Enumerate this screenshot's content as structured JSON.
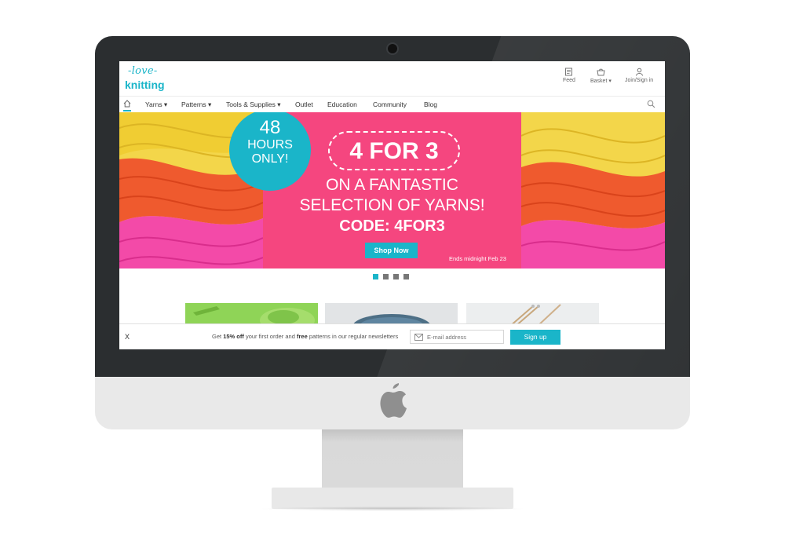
{
  "site": {
    "logo_top": "-love-",
    "logo_bottom": "knitting"
  },
  "header_tools": [
    {
      "label": "Feed",
      "icon": "feed-icon"
    },
    {
      "label": "Basket ▾",
      "icon": "basket-icon"
    },
    {
      "label": "Join/Sign in",
      "icon": "user-icon"
    }
  ],
  "nav": {
    "items": [
      {
        "label": "Yarns ▾"
      },
      {
        "label": "Patterns ▾"
      },
      {
        "label": "Tools & Supplies ▾"
      },
      {
        "label": "Outlet"
      },
      {
        "label": "Education"
      },
      {
        "label": "Community"
      },
      {
        "label": "Blog"
      }
    ],
    "home_icon": "home-icon",
    "search_icon": "search-icon"
  },
  "hero": {
    "badge_line1": "48",
    "badge_line2": "HOURS",
    "badge_line3": "ONLY!",
    "offer": "4 FOR 3",
    "subtitle_line1": "ON A FANTASTIC",
    "subtitle_line2": "SELECTION OF YARNS!",
    "code": "CODE: 4FOR3",
    "button": "Shop Now",
    "ends": "Ends midnight Feb 23"
  },
  "carousel": {
    "slides": 4,
    "active_index": 0
  },
  "newsletter": {
    "close": "X",
    "msg_prefix": "Get ",
    "msg_bold1": "15% off",
    "msg_mid": " your first order and ",
    "msg_bold2": "free",
    "msg_suffix": " patterns in our regular newsletters",
    "email_placeholder": "E-mail address",
    "button": "Sign up"
  },
  "colors": {
    "brand": "#1ab5c9",
    "hero_pink": "#f5467f",
    "bezel": "#2b2e30"
  }
}
